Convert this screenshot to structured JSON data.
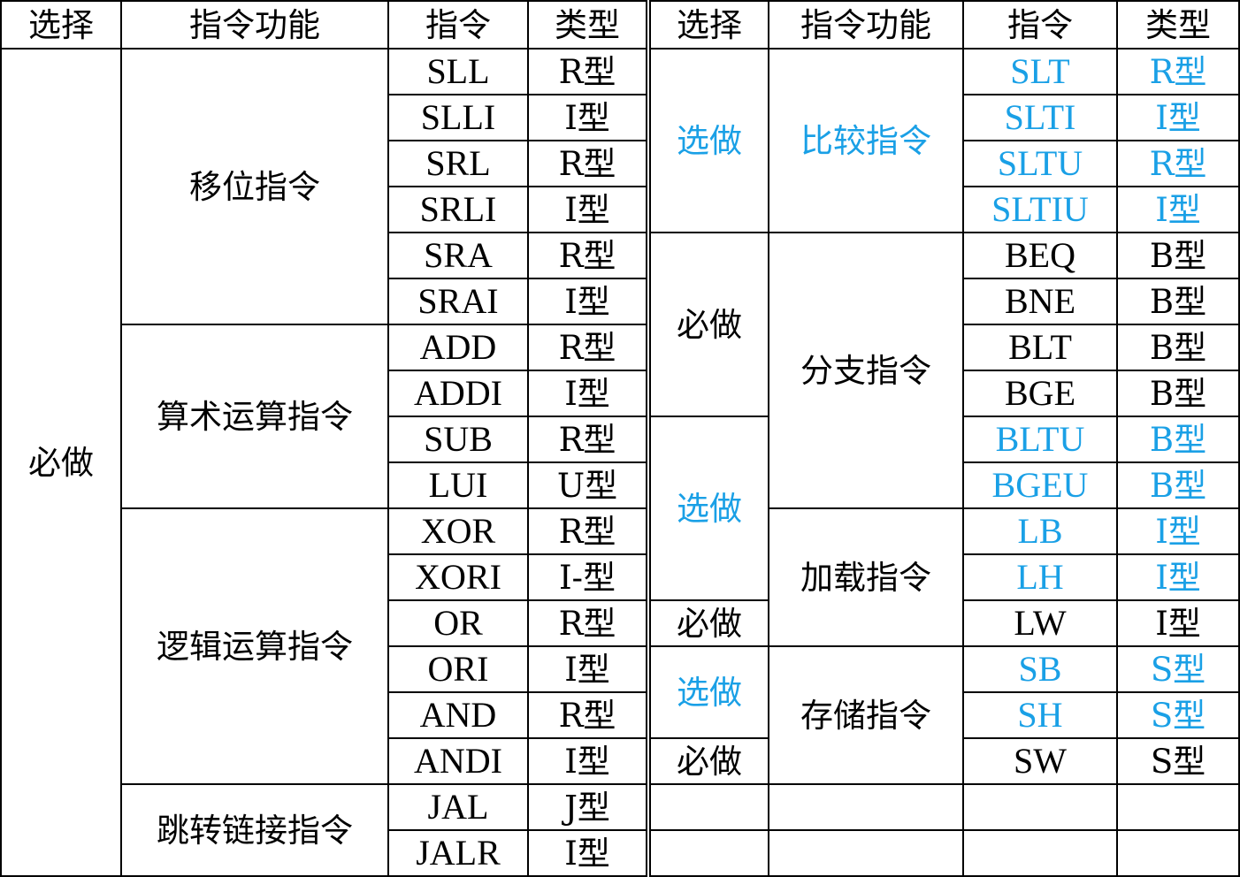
{
  "headers": {
    "select": "选择",
    "function": "指令功能",
    "instruction": "指令",
    "type": "类型"
  },
  "left": {
    "select_group": "必做",
    "groups": [
      {
        "function": "移位指令",
        "rows": [
          {
            "inst": "SLL",
            "type": "R型"
          },
          {
            "inst": "SLLI",
            "type": "I型"
          },
          {
            "inst": "SRL",
            "type": "R型"
          },
          {
            "inst": "SRLI",
            "type": "I型"
          },
          {
            "inst": "SRA",
            "type": "R型"
          },
          {
            "inst": "SRAI",
            "type": "I型"
          }
        ]
      },
      {
        "function": "算术运算指令",
        "rows": [
          {
            "inst": "ADD",
            "type": "R型"
          },
          {
            "inst": "ADDI",
            "type": "I型"
          },
          {
            "inst": "SUB",
            "type": "R型"
          },
          {
            "inst": "LUI",
            "type": "U型"
          }
        ]
      },
      {
        "function": "逻辑运算指令",
        "rows": [
          {
            "inst": "XOR",
            "type": "R型"
          },
          {
            "inst": "XORI",
            "type": "I-型"
          },
          {
            "inst": "OR",
            "type": "R型"
          },
          {
            "inst": "ORI",
            "type": "I型"
          },
          {
            "inst": "AND",
            "type": "R型"
          },
          {
            "inst": "ANDI",
            "type": "I型"
          }
        ]
      },
      {
        "function": "跳转链接指令",
        "rows": [
          {
            "inst": "JAL",
            "type": "J型"
          },
          {
            "inst": "JALR",
            "type": "I型"
          }
        ]
      }
    ]
  },
  "right": {
    "selects": [
      {
        "label": "选做",
        "blue": true
      },
      {
        "label": "必做",
        "blue": false
      },
      {
        "label": "选做",
        "blue": true
      },
      {
        "label": "必做",
        "blue": false
      },
      {
        "label": "选做",
        "blue": true
      },
      {
        "label": "必做",
        "blue": false
      }
    ],
    "functions": [
      {
        "label": "比较指令",
        "blue": true
      },
      {
        "label": "分支指令",
        "blue": false
      },
      {
        "label": "加载指令",
        "blue": false
      },
      {
        "label": "存储指令",
        "blue": false
      }
    ],
    "rows": [
      {
        "inst": "SLT",
        "type": "R型",
        "blue": true
      },
      {
        "inst": "SLTI",
        "type": "I型",
        "blue": true
      },
      {
        "inst": "SLTU",
        "type": "R型",
        "blue": true
      },
      {
        "inst": "SLTIU",
        "type": "I型",
        "blue": true
      },
      {
        "inst": "BEQ",
        "type": "B型",
        "blue": false
      },
      {
        "inst": "BNE",
        "type": "B型",
        "blue": false
      },
      {
        "inst": "BLT",
        "type": "B型",
        "blue": false
      },
      {
        "inst": "BGE",
        "type": "B型",
        "blue": false
      },
      {
        "inst": "BLTU",
        "type": "B型",
        "blue": true
      },
      {
        "inst": "BGEU",
        "type": "B型",
        "blue": true
      },
      {
        "inst": "LB",
        "type": "I型",
        "blue": true
      },
      {
        "inst": "LH",
        "type": "I型",
        "blue": true
      },
      {
        "inst": "LW",
        "type": "I型",
        "blue": false
      },
      {
        "inst": "SB",
        "type": "S型",
        "blue": true
      },
      {
        "inst": "SH",
        "type": "S型",
        "blue": true
      },
      {
        "inst": "SW",
        "type": "S型",
        "blue": false
      }
    ]
  },
  "colors": {
    "optional_text": "#1aa0e6",
    "required_text": "#000000",
    "border": "#000000"
  }
}
